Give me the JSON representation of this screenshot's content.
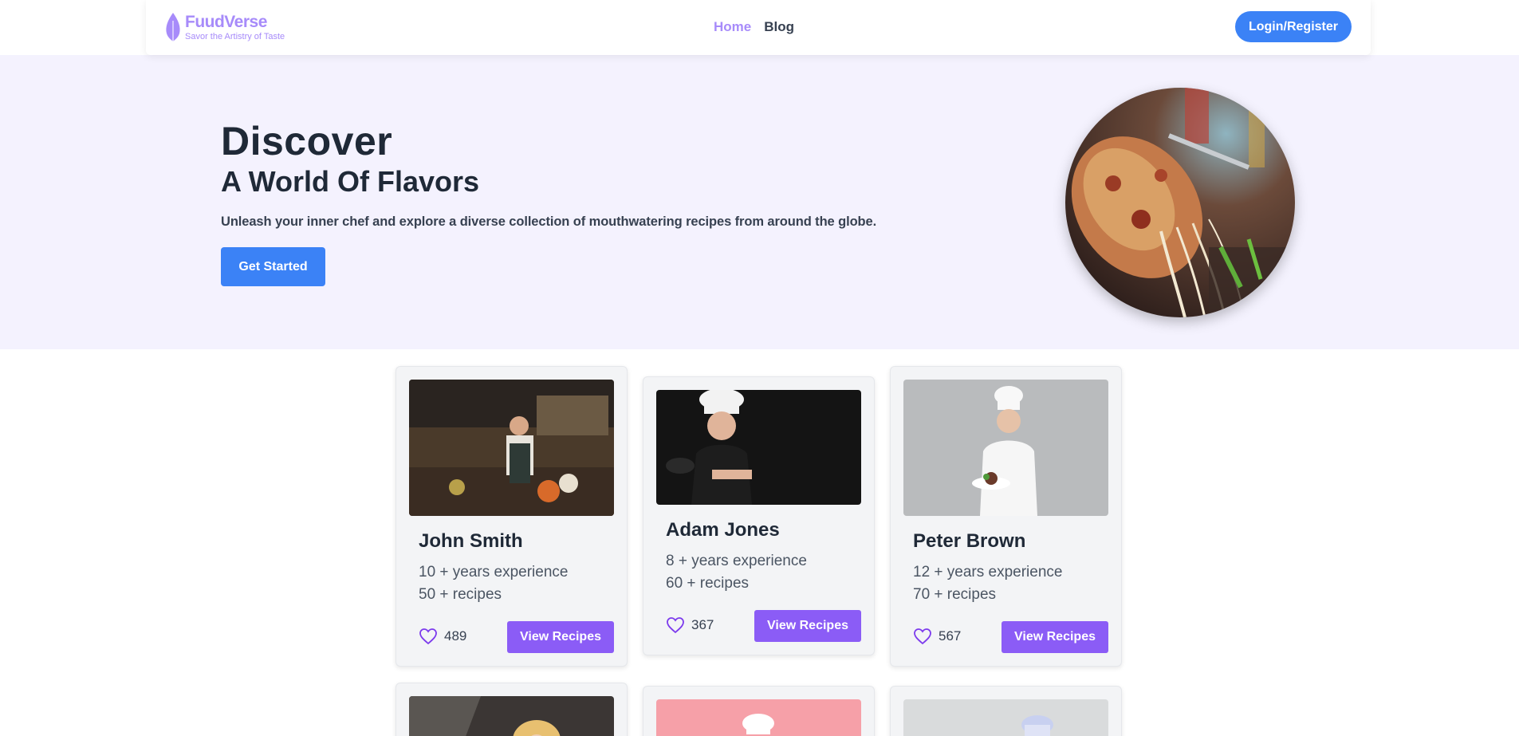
{
  "brand": {
    "name": "FuudVerse",
    "tagline": "Savor the Artistry of Taste",
    "accent": "#a78bfa"
  },
  "nav": {
    "home": "Home",
    "blog": "Blog"
  },
  "header": {
    "login_label": "Login/Register"
  },
  "hero": {
    "title": "Discover",
    "subtitle": "A World Of Flavors",
    "description": "Unleash your inner chef and explore a diverse collection of mouthwatering recipes from around the globe.",
    "cta_label": "Get Started"
  },
  "chefs": [
    {
      "name": "John Smith",
      "experience": "10 + years experience",
      "recipes": "50 + recipes",
      "likes": "489",
      "button": "View Recipes"
    },
    {
      "name": "Adam Jones",
      "experience": "8 + years experience",
      "recipes": "60 + recipes",
      "likes": "367",
      "button": "View Recipes"
    },
    {
      "name": "Peter Brown",
      "experience": "12 + years experience",
      "recipes": "70 + recipes",
      "likes": "567",
      "button": "View Recipes"
    }
  ],
  "colors": {
    "primary": "#3b82f6",
    "secondary": "#8b5cf6",
    "hero_bg": "#f4f2fe"
  }
}
